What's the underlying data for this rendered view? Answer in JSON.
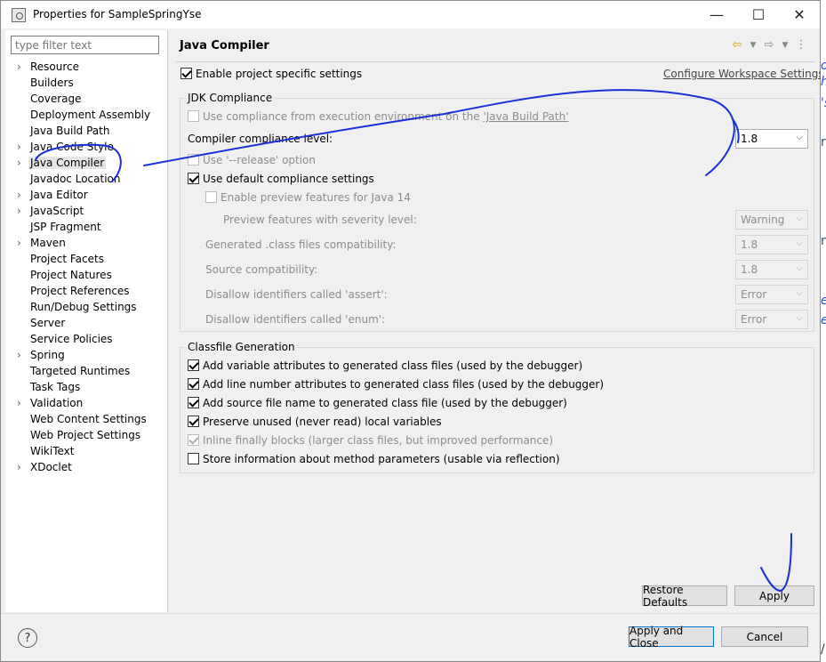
{
  "window": {
    "title": "Properties for SampleSpringYse",
    "controls": {
      "minimize": "—",
      "maximize": "☐",
      "close": "✕"
    }
  },
  "left_pane": {
    "filter_placeholder": "type filter text",
    "tree": [
      {
        "label": "Resource",
        "expandable": true
      },
      {
        "label": "Builders",
        "expandable": false
      },
      {
        "label": "Coverage",
        "expandable": false
      },
      {
        "label": "Deployment Assembly",
        "expandable": false
      },
      {
        "label": "Java Build Path",
        "expandable": false
      },
      {
        "label": "Java Code Style",
        "expandable": true
      },
      {
        "label": "Java Compiler",
        "expandable": true,
        "selected": true
      },
      {
        "label": "Javadoc Location",
        "expandable": false
      },
      {
        "label": "Java Editor",
        "expandable": true
      },
      {
        "label": "JavaScript",
        "expandable": true
      },
      {
        "label": "JSP Fragment",
        "expandable": false
      },
      {
        "label": "Maven",
        "expandable": true
      },
      {
        "label": "Project Facets",
        "expandable": false
      },
      {
        "label": "Project Natures",
        "expandable": false
      },
      {
        "label": "Project References",
        "expandable": false
      },
      {
        "label": "Run/Debug Settings",
        "expandable": false
      },
      {
        "label": "Server",
        "expandable": false
      },
      {
        "label": "Service Policies",
        "expandable": false
      },
      {
        "label": "Spring",
        "expandable": true
      },
      {
        "label": "Targeted Runtimes",
        "expandable": false
      },
      {
        "label": "Task Tags",
        "expandable": false
      },
      {
        "label": "Validation",
        "expandable": true
      },
      {
        "label": "Web Content Settings",
        "expandable": false
      },
      {
        "label": "Web Project Settings",
        "expandable": false
      },
      {
        "label": "WikiText",
        "expandable": false
      },
      {
        "label": "XDoclet",
        "expandable": true
      }
    ]
  },
  "page": {
    "title": "Java Compiler",
    "enable_project_specific": "Enable project specific settings",
    "configure_workspace_link": "Configure Workspace Settings...",
    "jdk": {
      "group_title": "JDK Compliance",
      "use_compliance_prefix": "Use compliance from execution environment on the ",
      "use_compliance_link": "'Java Build Path'",
      "compliance_level_label": "Compiler compliance level:",
      "compliance_level_value": "1.8",
      "release_option": "Use '--release' option",
      "use_default": "Use default compliance settings",
      "enable_preview": "Enable preview features for Java 14",
      "preview_severity_label": "Preview features with severity level:",
      "preview_severity_value": "Warning",
      "generated_class_label": "Generated .class files compatibility:",
      "generated_class_value": "1.8",
      "source_compat_label": "Source compatibility:",
      "source_compat_value": "1.8",
      "assert_label": "Disallow identifiers called 'assert':",
      "assert_value": "Error",
      "enum_label": "Disallow identifiers called 'enum':",
      "enum_value": "Error"
    },
    "classfile": {
      "group_title": "Classfile Generation",
      "options": [
        {
          "label": "Add variable attributes to generated class files (used by the debugger)",
          "checked": true,
          "disabled": false
        },
        {
          "label": "Add line number attributes to generated class files (used by the debugger)",
          "checked": true,
          "disabled": false
        },
        {
          "label": "Add source file name to generated class file (used by the debugger)",
          "checked": true,
          "disabled": false
        },
        {
          "label": "Preserve unused (never read) local variables",
          "checked": true,
          "disabled": false
        },
        {
          "label": "Inline finally blocks (larger class files, but improved performance)",
          "checked": true,
          "disabled": true
        },
        {
          "label": "Store information about method parameters (usable via reflection)",
          "checked": false,
          "disabled": false
        }
      ]
    },
    "restore_defaults": "Restore Defaults",
    "apply": "Apply"
  },
  "footer": {
    "help": "?",
    "apply_and_close": "Apply and Close",
    "cancel": "Cancel"
  },
  "background_text": [
    "o",
    "h",
    "'s",
    "ru",
    "n",
    "e",
    "e",
    "/"
  ],
  "colors": {
    "annotation_ink": "#1a2fd8",
    "accent": "#0078d7"
  }
}
